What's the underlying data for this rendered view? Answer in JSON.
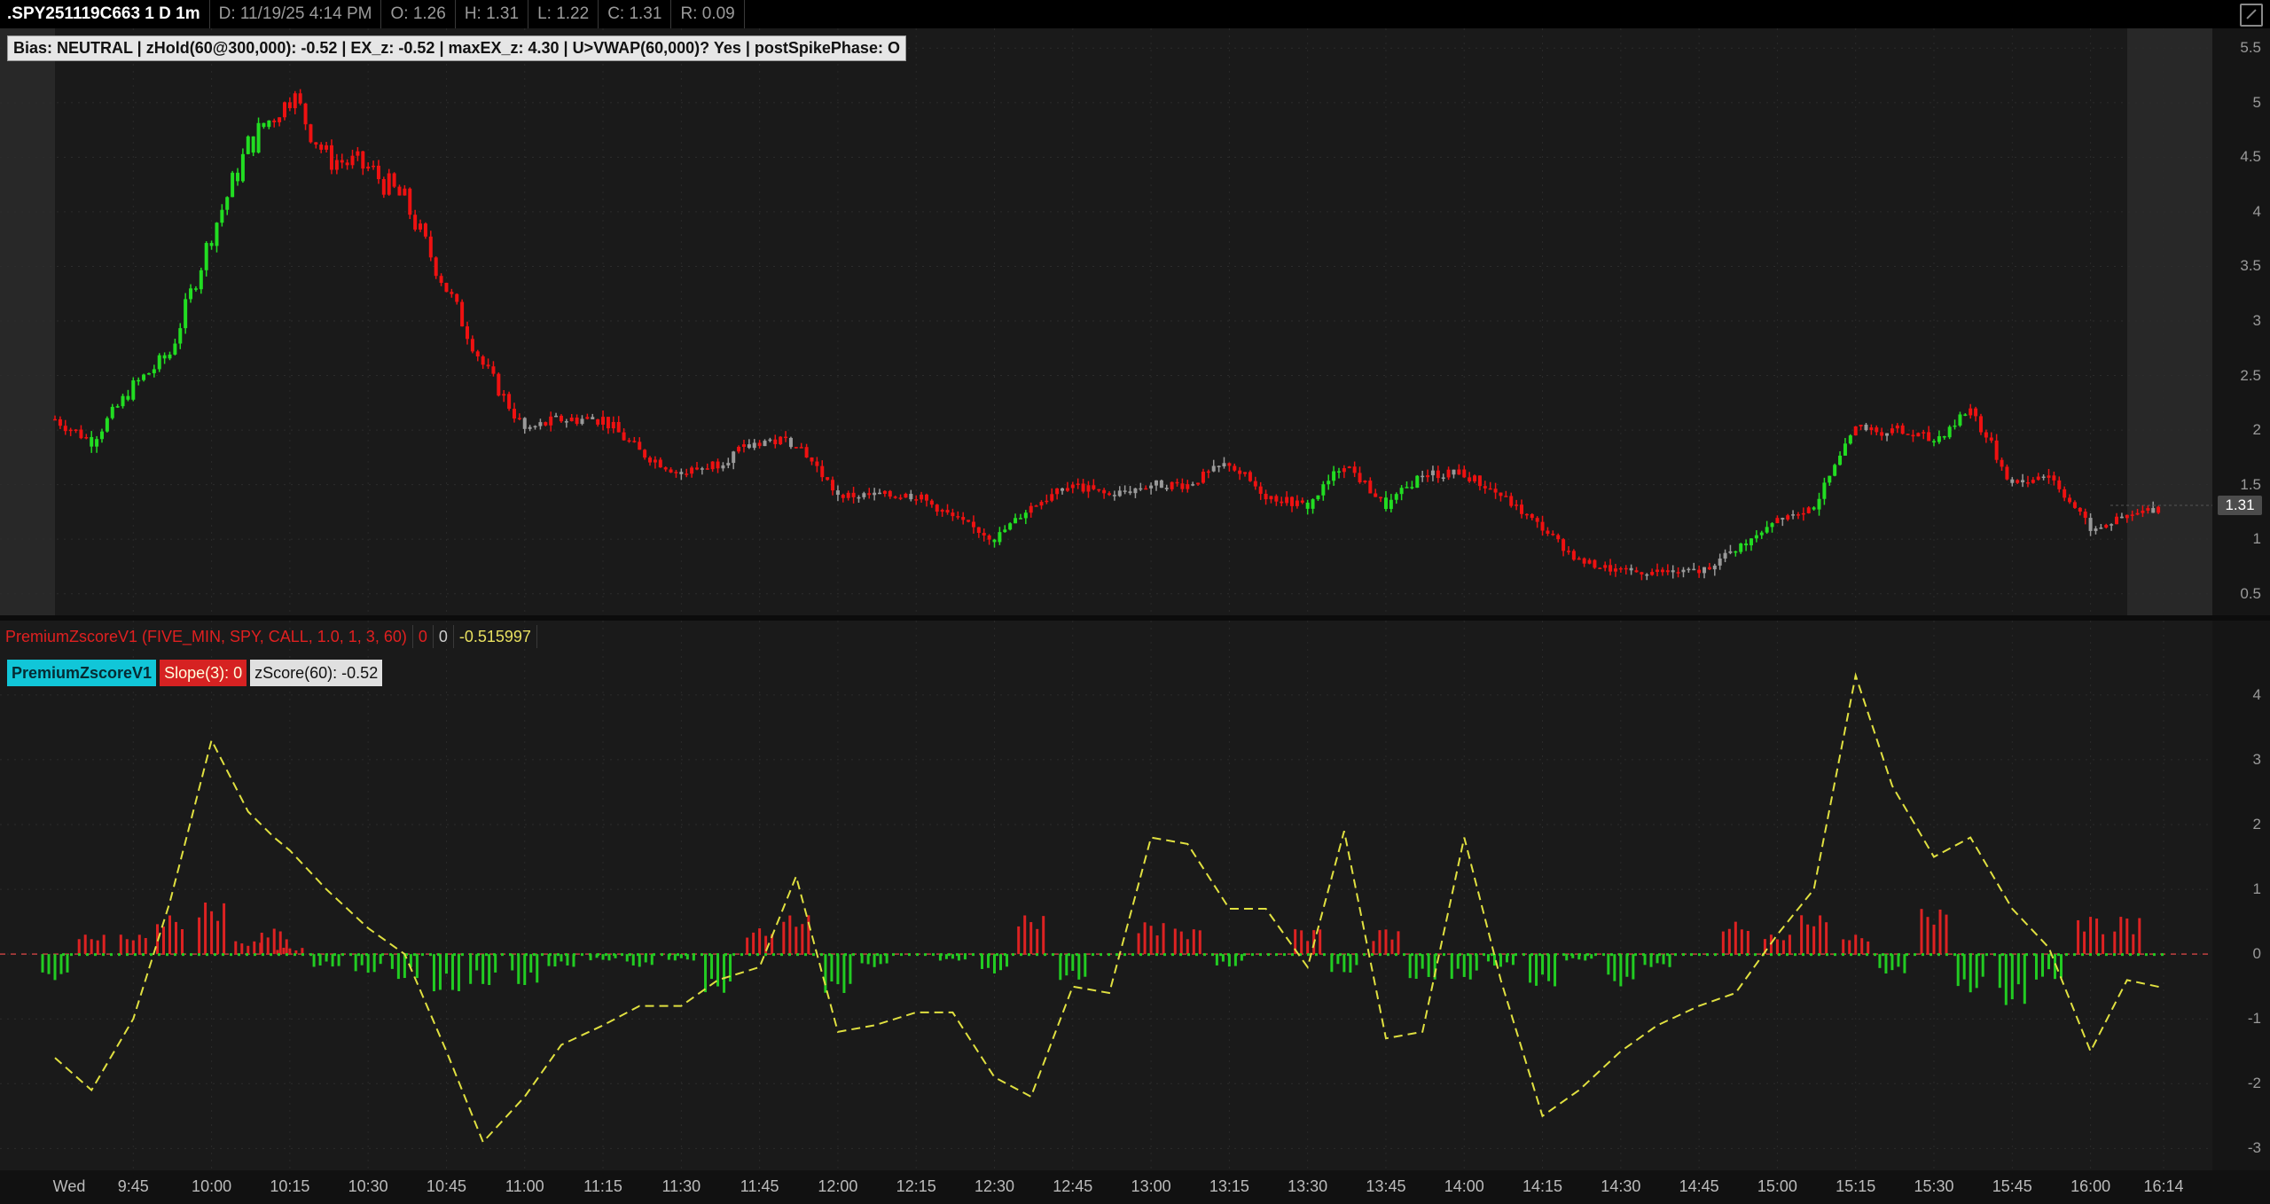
{
  "header": {
    "symbol": ".SPY251119C663 1 D 1m",
    "date": "D: 11/19/25 4:14 PM",
    "open": "O: 1.26",
    "high": "H: 1.31",
    "low": "L: 1.22",
    "close": "C: 1.31",
    "range": "R: 0.09"
  },
  "bias_label": "Bias: NEUTRAL  |  zHold(60@300,000): -0.52  |  EX_z: -0.52  |  maxEX_z: 4.30  |  U>VWAP(60,000)? Yes  |  postSpikePhase: O",
  "last_price": "1.31",
  "price_axis": [
    "5.5",
    "5",
    "4.5",
    "4",
    "3.5",
    "3",
    "2.5",
    "2",
    "1.5",
    "1",
    "0.5"
  ],
  "study": {
    "title": "PremiumZscoreV1 (FIVE_MIN, SPY, CALL, 1.0, 1, 3, 60)",
    "v1": "0",
    "v2": "0",
    "v3": "-0.515997",
    "legend": {
      "name": "PremiumZscoreV1",
      "slope": "Slope(3): 0",
      "zscore": "zScore(60): -0.52"
    },
    "axis": [
      "4",
      "3",
      "2",
      "1",
      "0",
      "-1",
      "-2",
      "-3"
    ]
  },
  "time_axis": [
    "Wed",
    "9:45",
    "10:00",
    "10:15",
    "10:30",
    "10:45",
    "11:00",
    "11:15",
    "11:30",
    "11:45",
    "12:00",
    "12:15",
    "12:30",
    "12:45",
    "13:00",
    "13:15",
    "13:30",
    "13:45",
    "14:00",
    "14:15",
    "14:30",
    "14:45",
    "15:00",
    "15:15",
    "15:30",
    "15:45",
    "16:00",
    "16:14"
  ],
  "colors": {
    "up": "#22dd22",
    "down": "#ee1111",
    "neutral": "#999999",
    "zscore_line": "#e0e040",
    "slope_pos": "#dd2222",
    "slope_neg": "#22cc22"
  },
  "chart_data": [
    {
      "type": "candlestick",
      "series_name": ".SPY251119C663 1m",
      "x": [
        "9:30",
        "9:37",
        "9:45",
        "9:52",
        "10:00",
        "10:07",
        "10:12",
        "10:15",
        "10:22",
        "10:30",
        "10:37",
        "10:45",
        "10:52",
        "11:00",
        "11:07",
        "11:15",
        "11:22",
        "11:30",
        "11:37",
        "11:45",
        "11:52",
        "12:00",
        "12:07",
        "12:15",
        "12:22",
        "12:30",
        "12:37",
        "12:45",
        "12:52",
        "13:00",
        "13:07",
        "13:15",
        "13:22",
        "13:30",
        "13:37",
        "13:45",
        "13:52",
        "14:00",
        "14:07",
        "14:15",
        "14:22",
        "14:30",
        "14:37",
        "14:45",
        "14:52",
        "15:00",
        "15:07",
        "15:15",
        "15:22",
        "15:30",
        "15:37",
        "15:45",
        "15:52",
        "16:00",
        "16:07",
        "16:14"
      ],
      "close": [
        2.1,
        1.9,
        2.4,
        2.7,
        3.8,
        4.6,
        4.9,
        5.1,
        4.5,
        4.4,
        4.1,
        3.3,
        2.6,
        2.0,
        2.1,
        2.1,
        1.8,
        1.6,
        1.7,
        1.9,
        1.9,
        1.4,
        1.4,
        1.4,
        1.2,
        1.0,
        1.3,
        1.5,
        1.4,
        1.5,
        1.5,
        1.7,
        1.4,
        1.3,
        1.7,
        1.3,
        1.6,
        1.6,
        1.4,
        1.1,
        0.8,
        0.7,
        0.7,
        0.7,
        0.9,
        1.2,
        1.3,
        2.0,
        2.0,
        1.9,
        2.2,
        1.5,
        1.6,
        1.1,
        1.2,
        1.31
      ],
      "ylim": [
        0.4,
        5.6
      ]
    },
    {
      "type": "line",
      "series_name": "zScore(60)",
      "x": [
        "9:30",
        "9:37",
        "9:45",
        "9:52",
        "10:00",
        "10:07",
        "10:12",
        "10:15",
        "10:22",
        "10:30",
        "10:37",
        "10:45",
        "10:52",
        "11:00",
        "11:07",
        "11:15",
        "11:22",
        "11:30",
        "11:37",
        "11:45",
        "11:52",
        "12:00",
        "12:07",
        "12:15",
        "12:22",
        "12:30",
        "12:37",
        "12:45",
        "12:52",
        "13:00",
        "13:07",
        "13:15",
        "13:22",
        "13:30",
        "13:37",
        "13:45",
        "13:52",
        "14:00",
        "14:07",
        "14:15",
        "14:22",
        "14:30",
        "14:37",
        "14:45",
        "14:52",
        "15:00",
        "15:07",
        "15:15",
        "15:22",
        "15:30",
        "15:37",
        "15:45",
        "15:52",
        "16:00",
        "16:07",
        "16:14"
      ],
      "values": [
        -1.6,
        -2.1,
        -1.0,
        0.8,
        3.3,
        2.2,
        1.8,
        1.6,
        1.0,
        0.4,
        0.0,
        -1.5,
        -2.9,
        -2.2,
        -1.4,
        -1.1,
        -0.8,
        -0.8,
        -0.4,
        -0.2,
        1.2,
        -1.2,
        -1.1,
        -0.9,
        -0.9,
        -1.9,
        -2.2,
        -0.5,
        -0.6,
        1.8,
        1.7,
        0.7,
        0.7,
        -0.2,
        1.9,
        -1.3,
        -1.2,
        1.8,
        -0.4,
        -2.5,
        -2.1,
        -1.5,
        -1.1,
        -0.8,
        -0.6,
        0.3,
        1.0,
        4.3,
        2.6,
        1.5,
        1.8,
        0.7,
        0.1,
        -1.5,
        -0.4,
        -0.52
      ],
      "ylim": [
        -3.2,
        4.6
      ]
    },
    {
      "type": "bar",
      "series_name": "Slope(3)",
      "x": [
        "9:30",
        "9:37",
        "9:45",
        "9:52",
        "10:00",
        "10:07",
        "10:12",
        "10:15",
        "10:22",
        "10:30",
        "10:37",
        "10:45",
        "10:52",
        "11:00",
        "11:07",
        "11:15",
        "11:22",
        "11:30",
        "11:37",
        "11:45",
        "11:52",
        "12:00",
        "12:07",
        "12:15",
        "12:22",
        "12:30",
        "12:37",
        "12:45",
        "12:52",
        "13:00",
        "13:07",
        "13:15",
        "13:22",
        "13:30",
        "13:37",
        "13:45",
        "13:52",
        "14:00",
        "14:07",
        "14:15",
        "14:22",
        "14:30",
        "14:37",
        "14:45",
        "14:52",
        "15:00",
        "15:07",
        "15:15",
        "15:22",
        "15:30",
        "15:37",
        "15:45",
        "15:52",
        "16:00",
        "16:07",
        "16:14"
      ],
      "values": [
        -0.4,
        0.3,
        0.3,
        0.6,
        0.8,
        0.2,
        0.4,
        0.1,
        -0.2,
        -0.3,
        -0.4,
        -0.6,
        -0.5,
        -0.5,
        -0.2,
        -0.1,
        -0.2,
        -0.1,
        -0.6,
        0.4,
        0.6,
        -0.6,
        -0.2,
        0.0,
        -0.1,
        -0.3,
        0.6,
        -0.4,
        0.0,
        0.5,
        0.4,
        -0.2,
        0.0,
        0.4,
        -0.3,
        0.4,
        -0.4,
        -0.4,
        -0.2,
        -0.5,
        -0.1,
        -0.5,
        -0.2,
        0.0,
        0.5,
        0.3,
        0.6,
        0.3,
        -0.3,
        0.7,
        -0.6,
        -0.8,
        -0.4,
        0.6,
        0.6,
        0.0
      ],
      "ylim": [
        -3.2,
        4.6
      ]
    }
  ]
}
